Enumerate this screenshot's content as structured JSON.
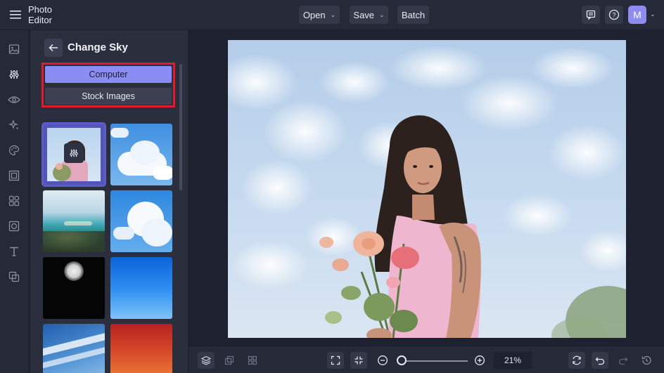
{
  "app": {
    "title": "Photo Editor",
    "menu": {
      "open": "Open",
      "save": "Save",
      "batch": "Batch"
    },
    "avatar_initial": "M",
    "accent": "#8b8cf4",
    "highlight_border": "#e01c2a"
  },
  "rail": {
    "items": [
      {
        "name": "image-icon",
        "active": false
      },
      {
        "name": "adjustments-icon",
        "active": true
      },
      {
        "name": "eye-icon",
        "active": false
      },
      {
        "name": "sparkle-icon",
        "active": false
      },
      {
        "name": "palette-icon",
        "active": false
      },
      {
        "name": "frame-icon",
        "active": false
      },
      {
        "name": "graphics-icon",
        "active": false
      },
      {
        "name": "overlay-icon",
        "active": false
      },
      {
        "name": "text-icon",
        "active": false
      },
      {
        "name": "layers-icon",
        "active": false
      }
    ]
  },
  "panel": {
    "title": "Change Sky",
    "sources": {
      "computer": "Computer",
      "stock": "Stock Images"
    },
    "thumbnails": [
      "current-image",
      "clouds",
      "coast",
      "clouds",
      "moon-night",
      "blue-gradient",
      "streaky-clouds",
      "red-sunset"
    ]
  },
  "canvas": {
    "zoom": "21%",
    "zoom_fraction": 0.06
  }
}
